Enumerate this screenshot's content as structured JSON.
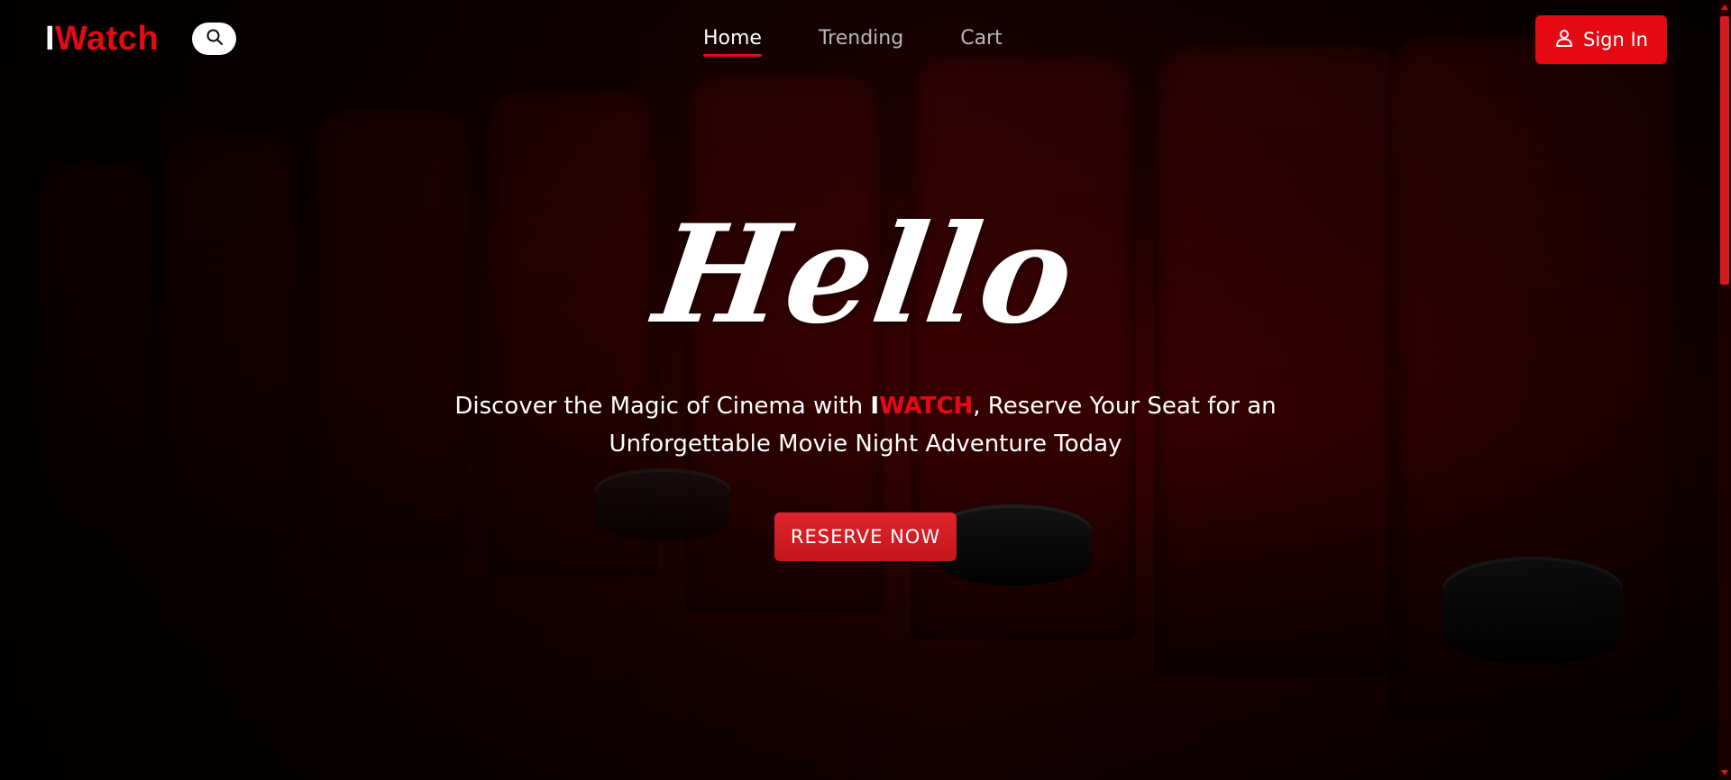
{
  "header": {
    "logo_first": "I",
    "logo_rest": "Watch",
    "nav": [
      {
        "label": "Home",
        "active": true
      },
      {
        "label": "Trending",
        "active": false
      },
      {
        "label": "Cart",
        "active": false
      }
    ],
    "signin_label": "Sign In"
  },
  "hero": {
    "greeting": "Hello",
    "tagline_before": "Discover the Magic of Cinema with ",
    "brand_first": "I",
    "brand_rest": "WATCH",
    "tagline_after": ", Reserve Your Seat for an Unforgettable Movie Night Adventure Today",
    "cta_label": "RESERVE NOW"
  },
  "icons": {
    "search": "search-icon",
    "user": "user-icon"
  },
  "colors": {
    "accent": "#e50914",
    "background": "#000000",
    "text": "#ffffff",
    "nav_inactive": "#b8b8b8"
  }
}
